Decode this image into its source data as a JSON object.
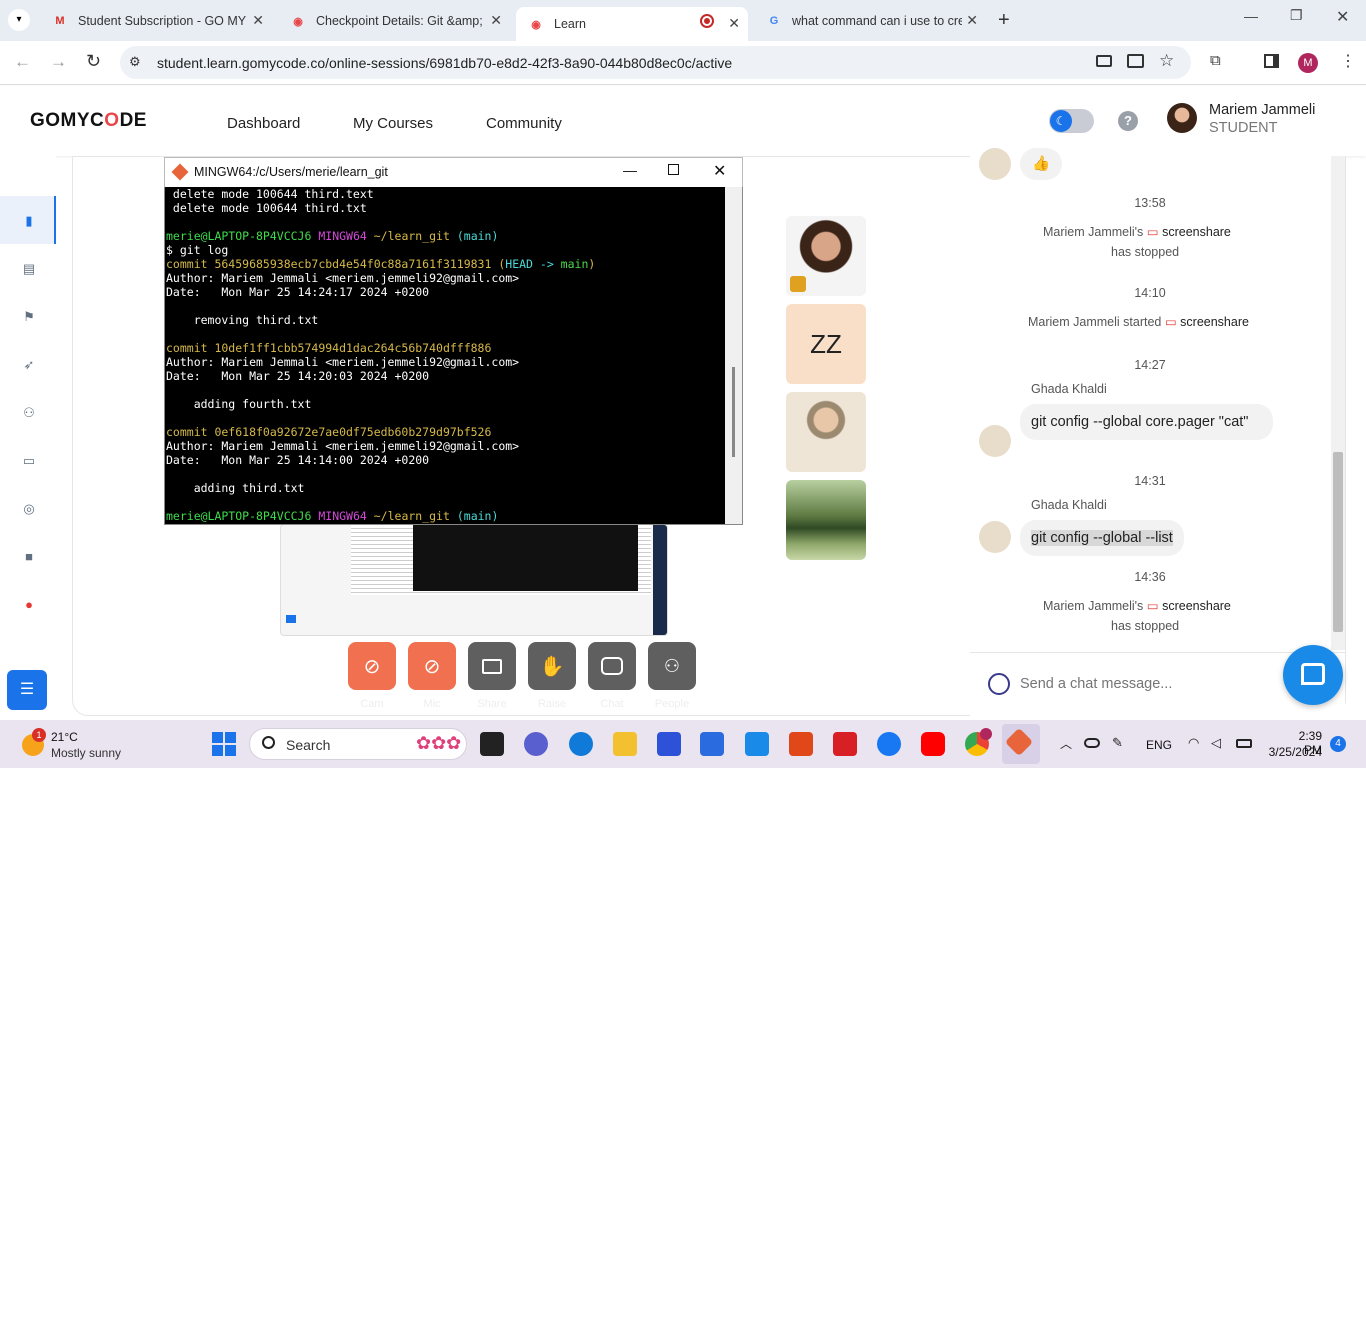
{
  "browser": {
    "tabs": [
      {
        "title": "Student Subscription - GO MY C",
        "icon": "gmail-icon"
      },
      {
        "title": "Checkpoint Details: Git &amp; G",
        "icon": "gomycode-icon"
      },
      {
        "title": "Learn",
        "icon": "gomycode-icon"
      },
      {
        "title": "what command can i use to cre",
        "icon": "google-icon"
      }
    ],
    "url": "student.learn.gomycode.co/online-sessions/6981db70-e8d2-42f3-8a90-044b80d8ec0c/active",
    "profile_initial": "M"
  },
  "header": {
    "logo_prefix": "GOMYC",
    "logo_accent": "O",
    "logo_suffix": "DE",
    "nav": [
      "Dashboard",
      "My Courses",
      "Community"
    ],
    "user_name": "Mariem Jammeli",
    "user_role": "STUDENT",
    "help": "?"
  },
  "terminal": {
    "title": "MINGW64:/c/Users/merie/learn_git",
    "lines_top": [
      " delete mode 100644 third.text",
      " delete mode 100644 third.txt",
      ""
    ],
    "prompt_user": "merie@LAPTOP-8P4VCCJ6",
    "prompt_sys": "MINGW64",
    "prompt_path": "~/learn_git",
    "prompt_branch": "(main)",
    "command": "$ git log",
    "commits": [
      {
        "hash": "commit 56459685938ecb7cbd4e54f0c88a7161f3119831",
        "ref_open": " (",
        "ref_head": "HEAD -> ",
        "ref_main": "main",
        "ref_close": ")",
        "author": "Author: Mariem Jemmali <meriem.jemmeli92@gmail.com>",
        "date": "Date:   Mon Mar 25 14:24:17 2024 +0200",
        "msg": "    removing third.txt"
      },
      {
        "hash": "commit 10def1ff1cbb574994d1dac264c56b740dfff886",
        "author": "Author: Mariem Jemmali <meriem.jemmeli92@gmail.com>",
        "date": "Date:   Mon Mar 25 14:20:03 2024 +0200",
        "msg": "    adding fourth.txt"
      },
      {
        "hash": "commit 0ef618f0a92672e7ae0df75edb60b279d97bf526",
        "author": "Author: Mariem Jemmali <meriem.jemmeli92@gmail.com>",
        "date": "Date:   Mon Mar 25 14:14:00 2024 +0200",
        "msg": "    adding third.txt"
      }
    ]
  },
  "participants": {
    "zz_label": "ZZ"
  },
  "controls": [
    {
      "label": "Cam",
      "icon": "camera-off-icon",
      "color": "#f0704f"
    },
    {
      "label": "Mic",
      "icon": "mic-off-icon",
      "color": "#f0704f"
    },
    {
      "label": "Share",
      "icon": "screen-share-icon",
      "color": "#5f5f5f"
    },
    {
      "label": "Raise",
      "icon": "hand-icon",
      "color": "#5f5f5f"
    },
    {
      "label": "Chat",
      "icon": "chat-icon",
      "color": "#5f5f5f"
    },
    {
      "label": "People",
      "icon": "people-icon",
      "color": "#5f5f5f"
    }
  ],
  "chat": {
    "thumb_emoji": "👍",
    "events": [
      {
        "time": "13:58",
        "line1_name": "Mariem Jammeli's",
        "line1_word": "screenshare",
        "line2": "has stopped"
      },
      {
        "time": "14:10",
        "line1_name": "Mariem Jammeli started",
        "line1_word": "screenshare"
      },
      {
        "time": "14:27",
        "sender": "Ghada Khaldi",
        "message": "git config --global core.pager \"cat\""
      },
      {
        "time": "14:31",
        "sender": "Ghada Khaldi",
        "message": "git config --global --list"
      },
      {
        "time": "14:36",
        "line1_name": "Mariem Jammeli's",
        "line1_word": "screenshare",
        "line2": "has stopped"
      }
    ],
    "input_placeholder": "Send a chat message..."
  },
  "taskbar": {
    "weather_temp": "21°C",
    "weather_desc": "Mostly sunny",
    "weather_badge": "1",
    "search_label": "Search",
    "lang": "ENG",
    "time": "2:39 PM",
    "date": "3/25/2024",
    "notif_count": "4"
  }
}
